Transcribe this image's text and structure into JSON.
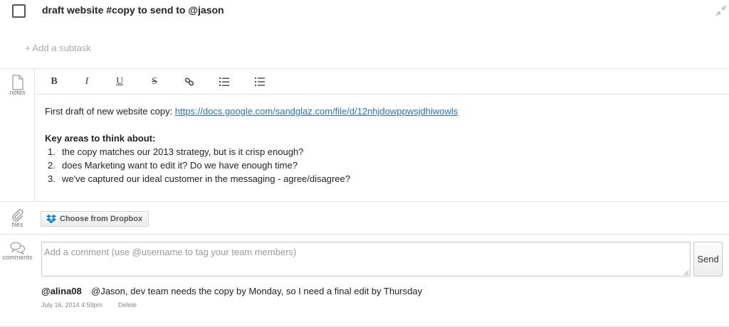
{
  "task": {
    "title": "draft website #copy to send to @jason"
  },
  "subtask": {
    "add_label": "+ Add a subtask"
  },
  "notes": {
    "section_label": "notes",
    "toolbar": {
      "bold": "B",
      "italic": "I",
      "underline": "U",
      "strikethrough": "S"
    },
    "intro_text": "First draft of new website copy: ",
    "link": "https://docs.google.com/sandglaz.com/file/d/12nhjdowppwsjdhiwowls",
    "key_heading": "Key areas to think about:",
    "items": [
      {
        "num": "1.",
        "text": "the copy matches our 2013 strategy, but is it crisp enough?"
      },
      {
        "num": "2.",
        "text": "does Marketing want to edit it? Do we have enough time?"
      },
      {
        "num": "3.",
        "text": "we've captured our ideal customer in the messaging - agree/disagree?"
      }
    ]
  },
  "files": {
    "section_label": "files",
    "dropbox_label": "Choose from Dropbox"
  },
  "comments": {
    "section_label": "comments",
    "placeholder": "Add a comment (use @username to tag your team members)",
    "send_label": "Send",
    "entries": [
      {
        "author": "@alina08",
        "text": "@Jason, dev team needs the copy by Monday, so I need a final edit by Thursday",
        "time": "July 16, 2014 4:59pm",
        "delete_label": "Delete"
      }
    ]
  },
  "colors": {
    "link": "#2a6fc9",
    "dropbox_blue": "#007ee5",
    "border": "#e3e3e3"
  },
  "icons": {
    "collapse": "collapse-arrows-icon",
    "notes": "document-icon",
    "files": "paperclip-icon",
    "comments": "speech-bubbles-icon",
    "dropbox": "dropbox-icon",
    "link": "chain-link-icon",
    "ordered_list": "ordered-list-icon",
    "unordered_list": "bullet-list-icon"
  }
}
